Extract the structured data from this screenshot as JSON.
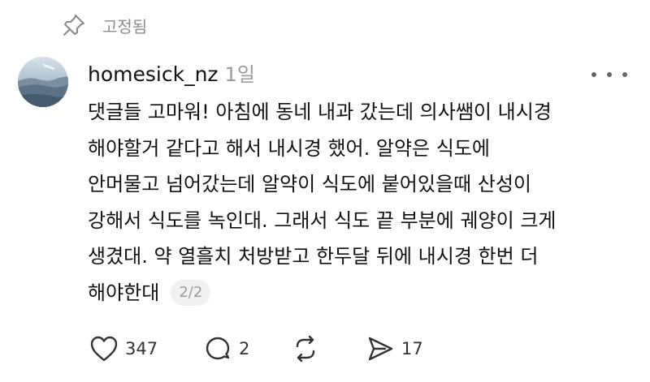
{
  "pinned": {
    "label": "고정됨",
    "icon": "pin-icon"
  },
  "author": {
    "username": "homesick_nz",
    "time": "1일",
    "avatar": "avatar-landscape-image"
  },
  "more_icon": "more-options-icon",
  "body_lines": [
    "댓글들 고마워! 아침에 동네 내과 갔는데 의사쌤이 내시경",
    "해야할거 같다고 해서 내시경 했어. 알약은 식도에",
    "안머물고 넘어갔는데 알약이 식도에 붙어있을때 산성이",
    "강해서 식도를 녹인대. 그래서 식도 끝 부분에 궤양이 크게",
    "생겼대. 약 열흘치 처방받고 한두달 뒤에 내시경 한번 더",
    "해야한대"
  ],
  "page_indicator": "2/2",
  "actions": {
    "like": {
      "icon": "heart-icon",
      "count": "347"
    },
    "reply": {
      "icon": "comment-icon",
      "count": "2"
    },
    "repost": {
      "icon": "repost-icon"
    },
    "share": {
      "icon": "share-icon",
      "count": "17"
    }
  },
  "colors": {
    "text": "#111111",
    "muted": "#8e8e8e",
    "badge_bg": "#f1f1f1"
  }
}
